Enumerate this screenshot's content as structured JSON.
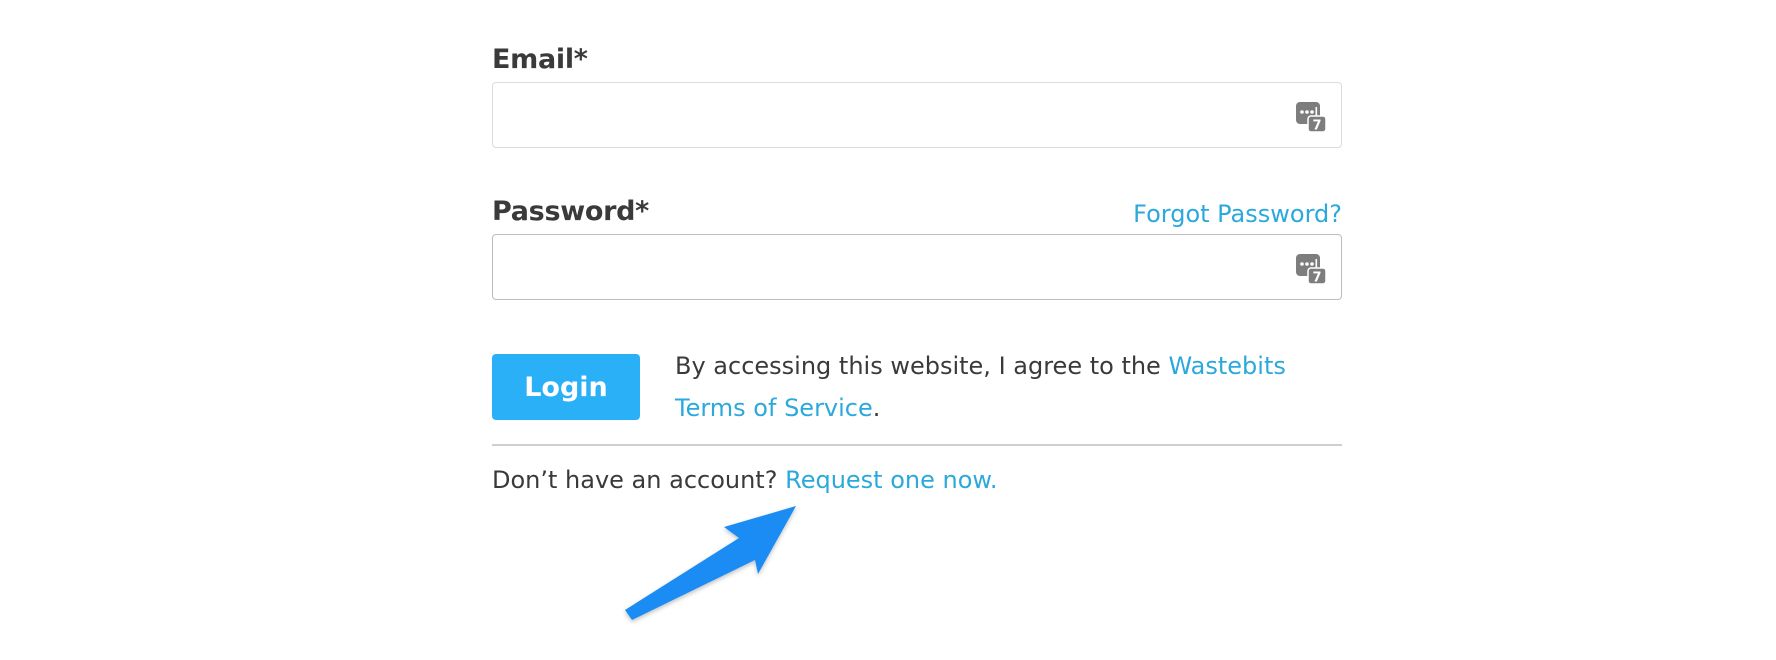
{
  "email": {
    "label": "Email*",
    "value": "",
    "icon": "password-manager-icon"
  },
  "password": {
    "label": "Password*",
    "value": "",
    "forgot_link": "Forgot Password?",
    "icon": "password-manager-icon"
  },
  "login": {
    "button_label": "Login"
  },
  "terms": {
    "prefix": "By accessing this website, I agree to the ",
    "link": "Wastebits Terms of Service",
    "suffix": "."
  },
  "signup": {
    "prompt": "Don’t have an account? ",
    "link": "Request one now."
  },
  "annotation": {
    "icon": "blue-arrow-icon",
    "color": "#1e8cf5"
  },
  "colors": {
    "link": "#2ba9dc",
    "button": "#29b0f7",
    "text": "#3a3a3a"
  }
}
